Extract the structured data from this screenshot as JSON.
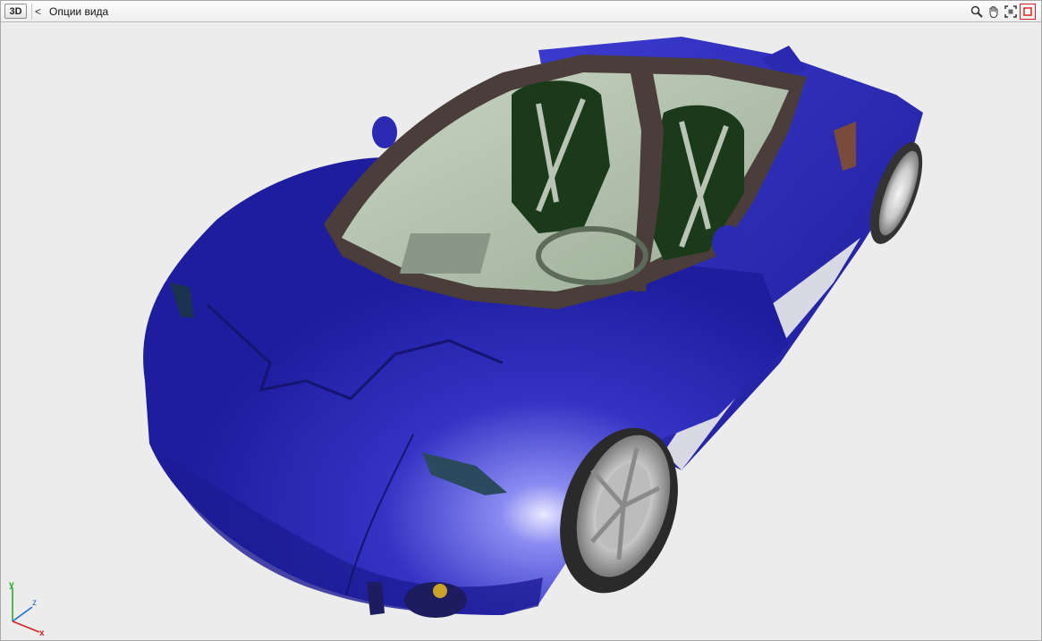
{
  "toolbar": {
    "view_mode_label": "3D",
    "back_glyph": "<",
    "title": "Опции вида",
    "tools": [
      {
        "name": "zoom-icon"
      },
      {
        "name": "pan-hand-icon"
      },
      {
        "name": "fit-view-icon"
      },
      {
        "name": "close-icon"
      }
    ]
  },
  "axes": {
    "y_label": "y",
    "z_label": "z",
    "x_label": "x"
  },
  "colors": {
    "body_blue": "#2b2ab5",
    "body_highlight": "#7b7bf0",
    "glass": "#b8c9b4",
    "seat": "#1a3a1a",
    "frame": "#4a3d3a",
    "axis_y": "#1aa81a",
    "axis_z": "#1a6bd6",
    "axis_x": "#d42020"
  }
}
